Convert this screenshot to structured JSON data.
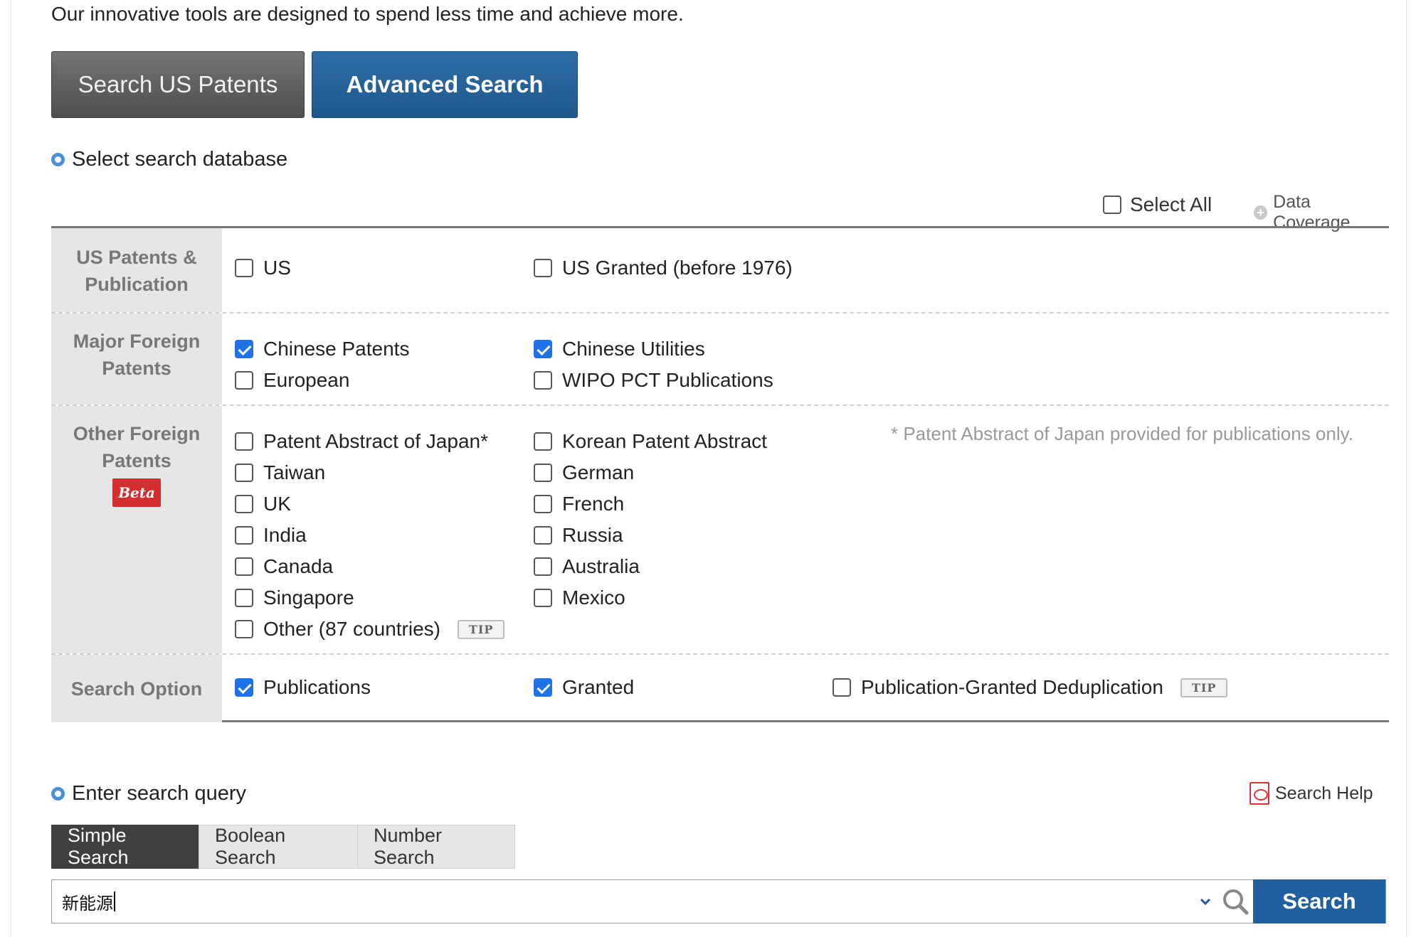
{
  "intro": "Our innovative tools are designed to spend less time and achieve more.",
  "top_buttons": {
    "us": "Search US Patents",
    "advanced": "Advanced Search"
  },
  "database": {
    "title": "Select search database",
    "select_all": "Select All",
    "data_coverage": "Data Coverage"
  },
  "rows": {
    "us": {
      "label_line1": "US Patents &",
      "label_line2": "Publication",
      "options": [
        {
          "label": "US",
          "checked": false
        },
        {
          "label": "US Granted (before 1976)",
          "checked": false
        }
      ]
    },
    "major": {
      "label_line1": "Major Foreign",
      "label_line2": "Patents",
      "options": [
        {
          "label": "Chinese Patents",
          "checked": true
        },
        {
          "label": "Chinese Utilities",
          "checked": true
        },
        {
          "label": "European",
          "checked": false
        },
        {
          "label": "WIPO PCT Publications",
          "checked": false
        }
      ]
    },
    "other": {
      "label_line1": "Other Foreign",
      "label_line2": "Patents",
      "beta": "Beta",
      "note": "* Patent Abstract of Japan provided for publications only.",
      "options": [
        {
          "label": "Patent Abstract of Japan*",
          "checked": false
        },
        {
          "label": "Korean Patent Abstract",
          "checked": false
        },
        {
          "label": "Taiwan",
          "checked": false
        },
        {
          "label": "German",
          "checked": false
        },
        {
          "label": "UK",
          "checked": false
        },
        {
          "label": "French",
          "checked": false
        },
        {
          "label": "India",
          "checked": false
        },
        {
          "label": "Russia",
          "checked": false
        },
        {
          "label": "Canada",
          "checked": false
        },
        {
          "label": "Australia",
          "checked": false
        },
        {
          "label": "Singapore",
          "checked": false
        },
        {
          "label": "Mexico",
          "checked": false
        },
        {
          "label": "Other (87 countries)",
          "checked": false
        }
      ],
      "tip": "TIP"
    },
    "option": {
      "label": "Search Option",
      "options": [
        {
          "label": "Publications",
          "checked": true
        },
        {
          "label": "Granted",
          "checked": true
        },
        {
          "label": "Publication-Granted Deduplication",
          "checked": false
        }
      ],
      "tip": "TIP"
    }
  },
  "query": {
    "title": "Enter search query",
    "help": "Search Help",
    "tabs": [
      "Simple Search",
      "Boolean Search",
      "Number Search"
    ],
    "active_tab": "Simple Search",
    "value": "新能源",
    "search_button": "Search"
  },
  "colors": {
    "accent": "#1e73e8",
    "advanced_button": "#2160a0",
    "us_button": "#5a5a5a",
    "beta": "#d32f2f"
  },
  "icons": [
    "info-dot-icon",
    "plus-circle-icon",
    "checkbox-icon",
    "pdf-icon",
    "chevron-down-icon",
    "search-icon"
  ]
}
